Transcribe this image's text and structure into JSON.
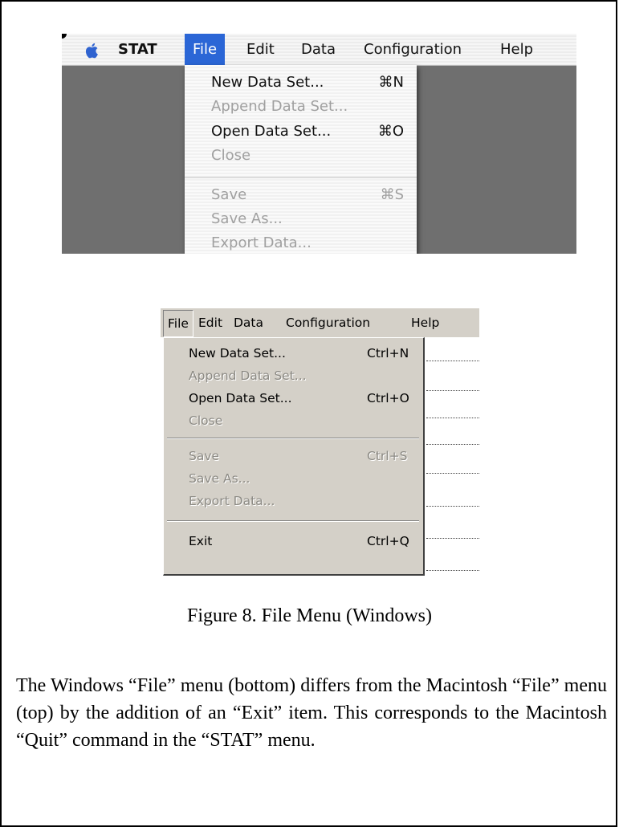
{
  "mac": {
    "app_name": "STAT",
    "menubar": [
      "File",
      "Edit",
      "Data",
      "Configuration",
      "Help"
    ],
    "active_menu": "File",
    "file_menu": [
      {
        "label": "New Data Set...",
        "shortcut": "⌘N",
        "enabled": true
      },
      {
        "label": "Append Data Set...",
        "shortcut": "",
        "enabled": false
      },
      {
        "label": "Open Data Set...",
        "shortcut": "⌘O",
        "enabled": true
      },
      {
        "label": "Close",
        "shortcut": "",
        "enabled": false
      },
      {
        "label": "Save",
        "shortcut": "⌘S",
        "enabled": false
      },
      {
        "label": "Save As...",
        "shortcut": "",
        "enabled": false
      },
      {
        "label": "Export Data...",
        "shortcut": "",
        "enabled": false
      }
    ]
  },
  "windows": {
    "menubar": [
      "File",
      "Edit",
      "Data",
      "Configuration",
      "Help"
    ],
    "active_menu": "File",
    "file_menu": [
      {
        "label": "New Data Set...",
        "shortcut": "Ctrl+N",
        "enabled": true
      },
      {
        "label": "Append Data Set...",
        "shortcut": "",
        "enabled": false
      },
      {
        "label": "Open Data Set...",
        "shortcut": "Ctrl+O",
        "enabled": true
      },
      {
        "label": "Close",
        "shortcut": "",
        "enabled": false
      },
      {
        "label": "Save",
        "shortcut": "Ctrl+S",
        "enabled": false
      },
      {
        "label": "Save As...",
        "shortcut": "",
        "enabled": false
      },
      {
        "label": "Export Data...",
        "shortcut": "",
        "enabled": false
      },
      {
        "label": "Exit",
        "shortcut": "Ctrl+Q",
        "enabled": true
      }
    ]
  },
  "caption": "Figure 8.  File Menu (Windows)",
  "paragraph": "The Windows “File” menu (bottom) differs from the Macintosh “File” menu (top) by the addition of an “Exit” item. This corresponds to the Macintosh “Quit” command in the “STAT” menu."
}
